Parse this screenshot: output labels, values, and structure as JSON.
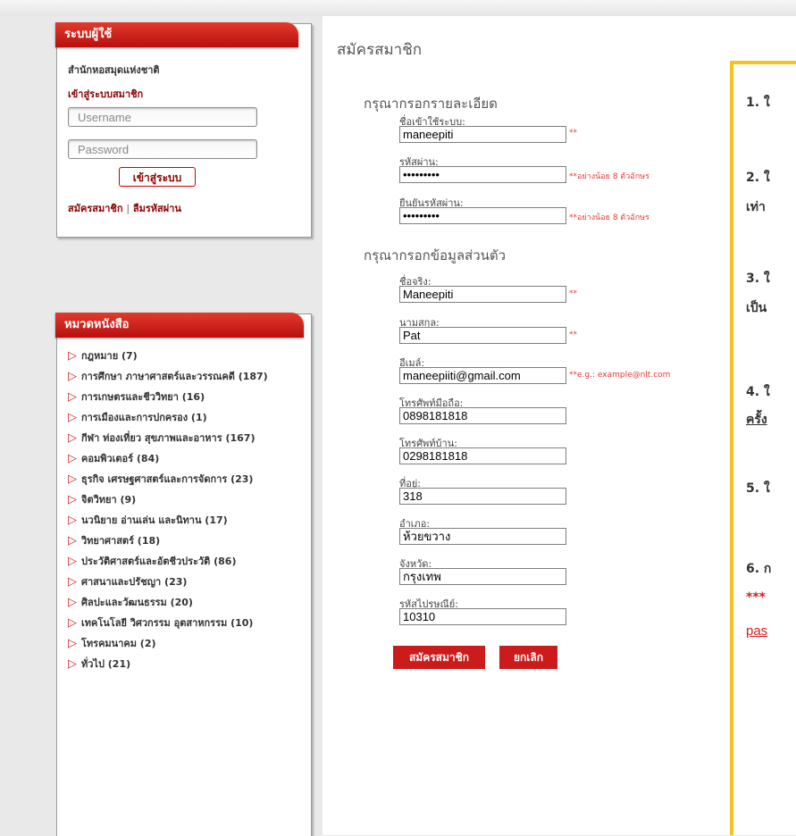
{
  "login": {
    "title": "ระบบผู้ใช้",
    "library": "สำนักหอสมุดแห่งชาติ",
    "member_login": "เข้าสู่ระบบสมาชิก",
    "username_placeholder": "Username",
    "password_placeholder": "Password",
    "login_button": "เข้าสู่ระบบ",
    "register_link": "สมัครสมาชิก",
    "separator": "|",
    "forgot_link": "ลืมรหัสผ่าน"
  },
  "categories": {
    "title": "หมวดหนังสือ",
    "items": [
      "กฎหมาย (7)",
      "การศึกษา ภาษาศาสตร์และวรรณคดี (187)",
      "การเกษตรและชีววิทยา (16)",
      "การเมืองและการปกครอง (1)",
      "กีฬา ท่องเที่ยว สุขภาพและอาหาร (167)",
      "คอมพิวเตอร์ (84)",
      "ธุรกิจ เศรษฐศาสตร์และการจัดการ (23)",
      "จิตวิทยา (9)",
      "นวนิยาย อ่านเล่น และนิทาน (17)",
      "วิทยาศาสตร์ (18)",
      "ประวัติศาสตร์และอัตชีวประวัติ (86)",
      "ศาสนาและปรัชญา (23)",
      "ศิลปะและวัฒนธรรม (20)",
      "เทคโนโลยี วิศวกรรม อุตสาหกรรม (10)",
      "โทรคมนาคม (2)",
      "ทั่วไป (21)"
    ]
  },
  "form": {
    "page_title": "สมัครสมาชิก",
    "section_account": "กรุณากรอกรายละเอียด",
    "section_personal": "กรุณากรอกข้อมูลส่วนตัว",
    "username_label": "ชื่อเข้าใช้ระบบ:",
    "username_value": "maneepiti",
    "username_note": "**",
    "password_label": "รหัสผ่าน:",
    "password_value": "•••••••••",
    "password_note": "**อย่างน้อย 8 ตัวอักษร",
    "confirm_label": "ยืนยันรหัสผ่าน:",
    "confirm_value": "•••••••••",
    "confirm_note": "**อย่างน้อย 8 ตัวอักษร",
    "firstname_label": "ชื่อจริง:",
    "firstname_value": "Maneepiti",
    "firstname_note": "**",
    "lastname_label": "นามสกุล:",
    "lastname_value": "Pat",
    "lastname_note": "**",
    "email_label": "อีเมล์:",
    "email_value": "maneepiiti@gmail.com",
    "email_note": "**e.g.: example@nlt.com",
    "mobile_label": "โทรศัพท์มือถือ:",
    "mobile_value": "0898181818",
    "home_phone_label": "โทรศัพท์บ้าน:",
    "home_phone_value": "0298181818",
    "address_label": "ที่อยู่:",
    "address_value": "318",
    "district_label": "อำเภอ:",
    "district_value": "ห้วยขวาง",
    "province_label": "จังหวัด:",
    "province_value": "กรุงเทพ",
    "postcode_label": "รหัสไปรษณีย์:",
    "postcode_value": "10310",
    "submit_button": "สมัครสมาชิก",
    "cancel_button": "ยกเลิก"
  },
  "instructions": {
    "items": [
      "1. ใ",
      "2. ใ",
      "เท่า",
      "3. ใ",
      "เป็น",
      "4. ใ",
      "ครั้ง",
      "5. ใ",
      "6. ก",
      "***",
      "pas"
    ]
  },
  "colors": {
    "accent_red": "#cc1b1b",
    "overlay_border": "#f7c21f"
  }
}
